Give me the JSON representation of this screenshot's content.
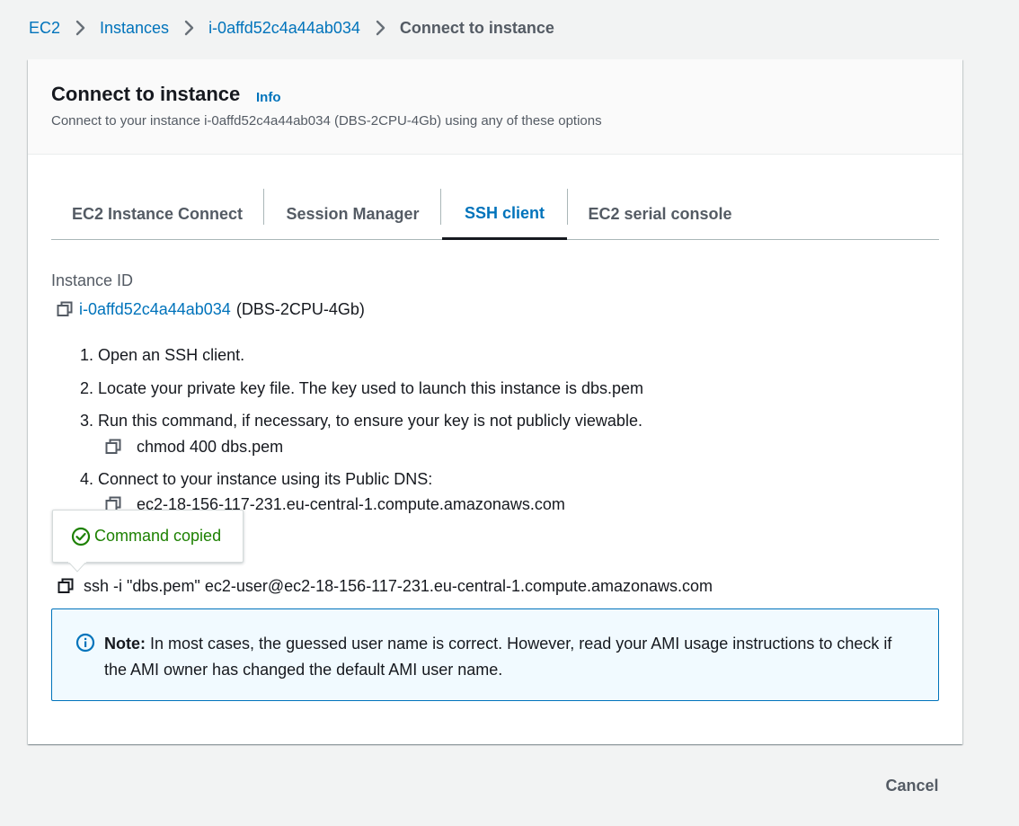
{
  "breadcrumb": {
    "items": [
      {
        "label": "EC2"
      },
      {
        "label": "Instances"
      },
      {
        "label": "i-0affd52c4a44ab034"
      },
      {
        "label": "Connect to instance"
      }
    ]
  },
  "header": {
    "title": "Connect to instance",
    "info_label": "Info",
    "description": "Connect to your instance i-0affd52c4a44ab034 (DBS-2CPU-4Gb) using any of these options"
  },
  "tabs": [
    {
      "label": "EC2 Instance Connect",
      "active": false
    },
    {
      "label": "Session Manager",
      "active": false
    },
    {
      "label": "SSH client",
      "active": true
    },
    {
      "label": "EC2 serial console",
      "active": false
    }
  ],
  "instance": {
    "label": "Instance ID",
    "id": "i-0affd52c4a44ab034",
    "name_suffix": "(DBS-2CPU-4Gb)"
  },
  "steps": {
    "s1": "1. Open an SSH client.",
    "s2": "2. Locate your private key file. The key used to launch this instance is dbs.pem",
    "s3": "3. Run this command, if necessary, to ensure your key is not publicly viewable.",
    "s3_command": "chmod 400 dbs.pem",
    "s4": "4. Connect to your instance using its Public DNS:",
    "s4_dns": "ec2-18-156-117-231.eu-central-1.compute.amazonaws.com",
    "ssh_command": "ssh -i \"dbs.pem\" ec2-user@ec2-18-156-117-231.eu-central-1.compute.amazonaws.com"
  },
  "toast": {
    "message": "Command copied"
  },
  "note": {
    "bold": "Note:",
    "text": " In most cases, the guessed user name is correct. However, read your AMI usage instructions to check if the AMI owner has changed the default AMI user name."
  },
  "footer": {
    "cancel_label": "Cancel"
  },
  "colors": {
    "link": "#0073bb",
    "success": "#1d8102",
    "info_bg": "#f1faff",
    "text_muted": "#545b64"
  },
  "icons": {
    "copy": "copy-icon",
    "chevron": "chevron-right-icon",
    "success": "check-circle-icon",
    "info": "info-circle-icon"
  }
}
